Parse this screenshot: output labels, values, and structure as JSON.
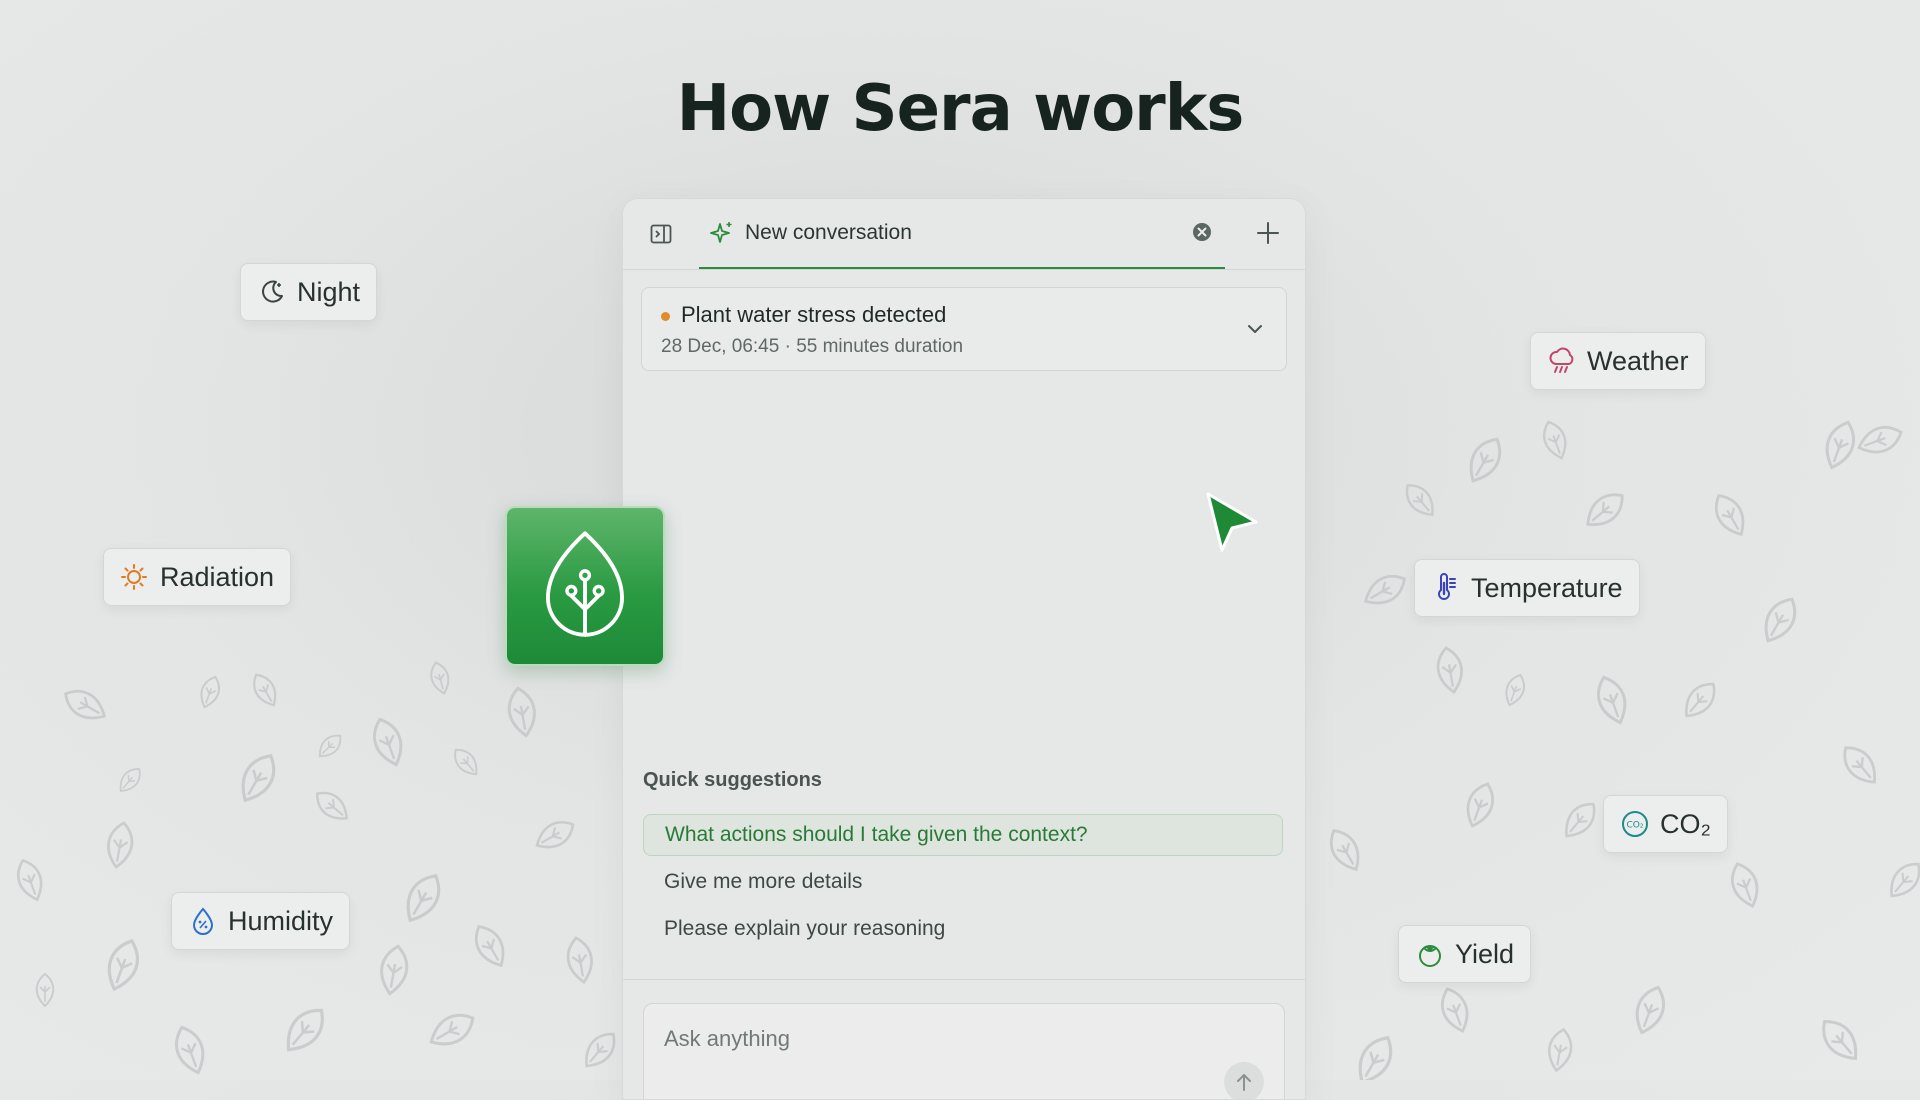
{
  "headline": "How Sera works",
  "panel": {
    "tab_label": "New conversation",
    "alert": {
      "title": "Plant water stress detected",
      "meta": "28 Dec, 06:45 · 55 minutes duration"
    },
    "quick_suggestions": {
      "title": "Quick suggestions",
      "items": [
        "What actions should I take given the context?",
        "Give me more details",
        "Please explain your reasoning"
      ]
    },
    "input_placeholder": "Ask anything"
  },
  "chips": {
    "night": "Night",
    "radiation": "Radiation",
    "humidity": "Humidity",
    "weather": "Weather",
    "temperature": "Temperature",
    "co2": "CO₂",
    "yield": "Yield"
  },
  "colors": {
    "brand_green": "#2e8b3e",
    "alert_dot": "#e08b2c",
    "weather_icon": "#c2456a",
    "temperature_icon": "#3a44b8",
    "radiation_icon": "#e07b22",
    "humidity_icon": "#2b6fd0",
    "co2_icon": "#1f8a8a",
    "yield_icon": "#2e8b3e"
  }
}
